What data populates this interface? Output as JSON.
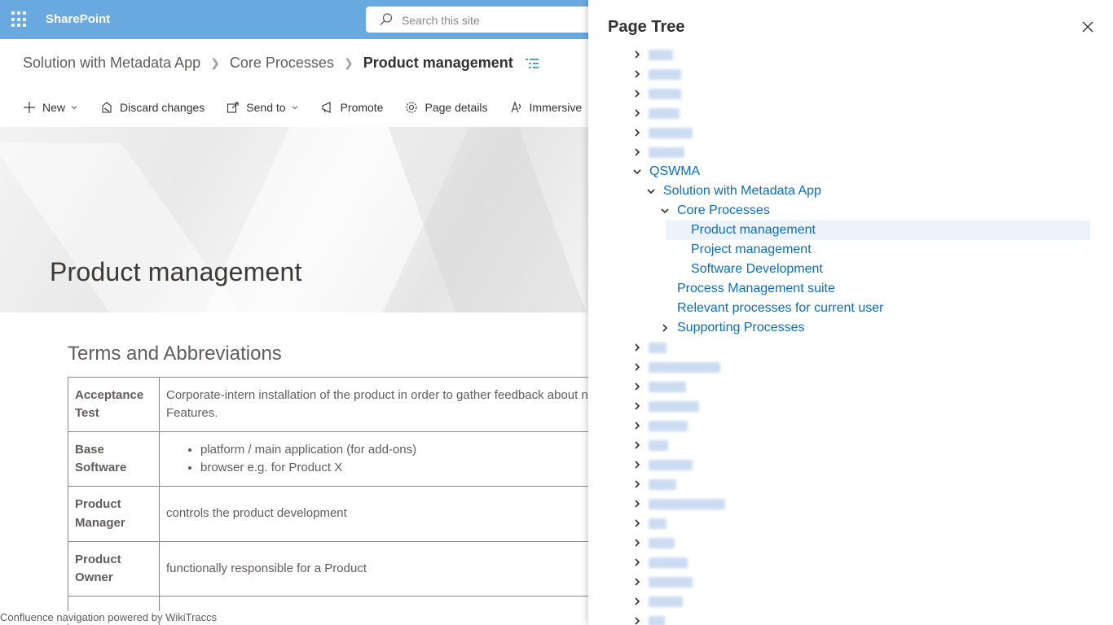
{
  "suitebar": {
    "brand": "SharePoint",
    "search_placeholder": "Search this site"
  },
  "breadcrumb": {
    "items": [
      "Solution with Metadata App",
      "Core Processes"
    ],
    "current": "Product management"
  },
  "commandbar": {
    "new": "New",
    "discard": "Discard changes",
    "send_to": "Send to",
    "promote": "Promote",
    "page_details": "Page details",
    "immersive": "Immersive"
  },
  "page": {
    "title": "Product management",
    "section_title": "Terms and Abbreviations",
    "terms": [
      {
        "term": "Acceptance Test",
        "definition": "Corporate-intern installation of the product in order to gather feedback about new Product Features."
      },
      {
        "term": "Base Software",
        "bullets": [
          "platform / main application (for add-ons)",
          "browser e.g. for Product X"
        ]
      },
      {
        "term": "Product Manager",
        "definition": "controls the product development"
      },
      {
        "term": "Product Owner",
        "definition": "functionally responsible for a Product"
      }
    ]
  },
  "footer_note": "Confluence navigation powered by WikiTraccs",
  "panel": {
    "title": "Page Tree",
    "tree": {
      "qswma": "QSWMA",
      "solution": "Solution with Metadata App",
      "core": "Core Processes",
      "product_mgmt": "Product management",
      "project_mgmt": "Project management",
      "software_dev": "Software Development",
      "process_suite": "Process Management suite",
      "relevant": "Relevant processes for current user",
      "supporting": "Supporting Processes"
    }
  },
  "colors": {
    "suitebar": "#6aa9e0",
    "link": "#0f6cbd",
    "selected_row": "#edf3fb"
  }
}
